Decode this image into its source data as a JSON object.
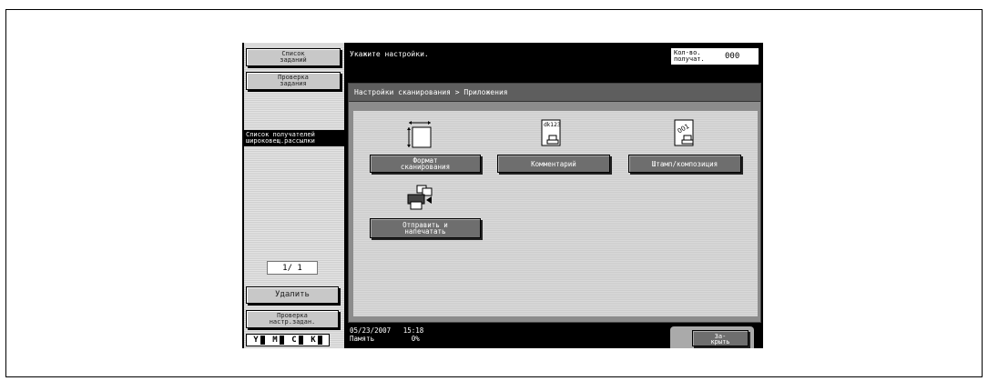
{
  "left_panel": {
    "job_list": "Список\nзаданий",
    "job_check": "Проверка\nзадания",
    "distribution": "Список получателей\nшироковещ.рассылки",
    "page_counter": "1/  1",
    "delete": "Удалить",
    "check_settings": "Проверка\nнастр.задан.",
    "toner": [
      "Y",
      "M",
      "C",
      "K"
    ]
  },
  "header": {
    "message": "Укажите настройки.",
    "recipients_label": "Кол-во.\nполучат.",
    "recipients_value": "000"
  },
  "breadcrumb": "Настройки сканирования > Приложения",
  "functions": {
    "scan_format": "Формат\nсканирования",
    "comment": "Комментарий",
    "stamp": "Штамп/композиция",
    "send_print": "Отправить и\nнапечатать",
    "comment_icon_text": "dk123",
    "stamp_icon_text": "001"
  },
  "status": {
    "datetime": "05/23/2007   15:18",
    "memory": "Память         0%"
  },
  "close": "За-\nкрыть"
}
